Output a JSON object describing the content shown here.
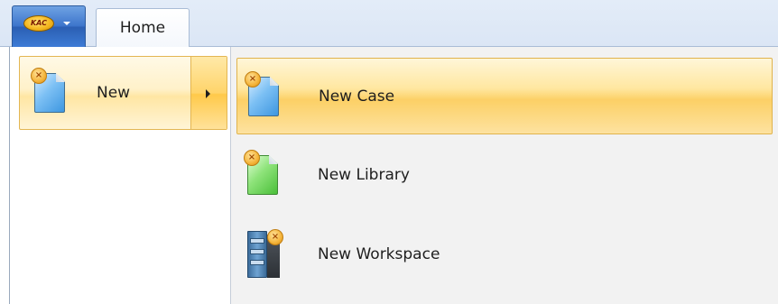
{
  "ribbon": {
    "app_button": {
      "logo_text": "KAC",
      "icon": "app-logo-icon"
    },
    "tabs": [
      {
        "label": "Home"
      }
    ]
  },
  "app_menu": {
    "items": [
      {
        "label": "New",
        "icon": "new-document-icon",
        "has_submenu": true,
        "highlighted": true
      }
    ],
    "submenu": [
      {
        "label": "New Case",
        "icon": "new-case-icon",
        "highlighted": true
      },
      {
        "label": "New Library",
        "icon": "new-library-icon",
        "highlighted": false
      },
      {
        "label": "New Workspace",
        "icon": "new-workspace-icon",
        "highlighted": false
      }
    ]
  },
  "colors": {
    "highlight": "#ffd46a",
    "ribbon_bg": "#dbe6f5",
    "app_button": "#3d76cc",
    "submenu_bg": "#f2f2f2"
  }
}
